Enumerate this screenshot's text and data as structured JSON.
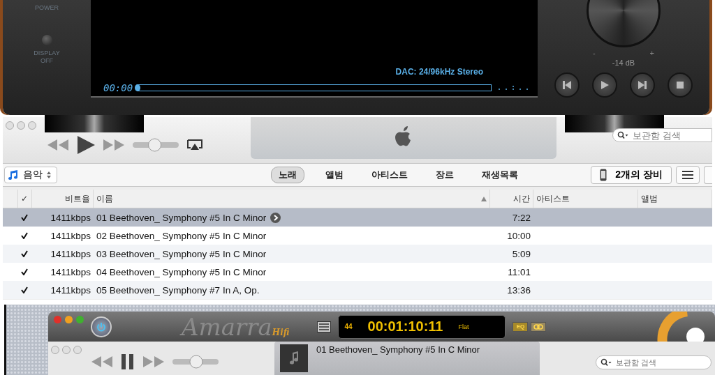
{
  "amplifier": {
    "power_label": "POWER",
    "display_off_label": "DISPLAY OFF",
    "time": "00:00",
    "progress": {
      "level": 0
    },
    "dac": "DAC: 24/96kHz Stereo",
    "volume_minus": "-",
    "volume_plus": "+",
    "volume_reading": "-14 dB"
  },
  "itunes": {
    "volume": {
      "level": 0.47
    },
    "search": {
      "placeholder": "보관함 검색"
    },
    "library": "음악",
    "tabs": [
      {
        "label": "노래",
        "selected": true
      },
      {
        "label": "앨범",
        "selected": false
      },
      {
        "label": "아티스트",
        "selected": false
      },
      {
        "label": "장르",
        "selected": false
      },
      {
        "label": "재생목록",
        "selected": false
      }
    ],
    "devices": "2개의 장비",
    "columns": [
      "✓",
      "비트율",
      "이름",
      "시간",
      "아티스트",
      "앨범"
    ],
    "rows": [
      {
        "checked": true,
        "selected": true,
        "bitrate": "1411kbps",
        "name": "01 Beethoven_ Symphony #5 In C Minor",
        "time": "7:22"
      },
      {
        "checked": true,
        "selected": false,
        "bitrate": "1411kbps",
        "name": "02 Beethoven_ Symphony #5 In C Minor",
        "time": "10:00"
      },
      {
        "checked": true,
        "selected": false,
        "bitrate": "1411kbps",
        "name": "03 Beethoven_ Symphony #5 In C Minor",
        "time": "5:09"
      },
      {
        "checked": true,
        "selected": false,
        "bitrate": "1411kbps",
        "name": "04 Beethoven_ Symphony #5 In C Minor",
        "time": "11:01"
      },
      {
        "checked": true,
        "selected": false,
        "bitrate": "1411kbps",
        "name": "05 Beethoven_ Symphony #7 In A, Op.",
        "time": "13:36"
      }
    ]
  },
  "amarra": {
    "logo": "Amarra",
    "logo_suffix": "Hifi",
    "sample_rate": "44",
    "counter": "00:01:10:11",
    "eq_preset": "Flat",
    "eq_button": "EQ",
    "mini_player": {
      "volume": {
        "level": 0.52
      },
      "now_playing": "01 Beethoven_ Symphony #5 In C Minor",
      "search": {
        "placeholder": "보관함 검색"
      }
    }
  }
}
